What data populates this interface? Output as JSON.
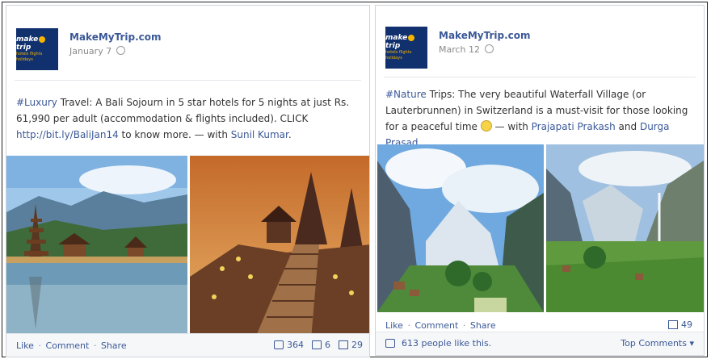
{
  "posts": [
    {
      "page_name": "MakeMyTrip.com",
      "date": "January 7",
      "logo": {
        "line1": "make",
        "line2": "trip",
        "tagline": "hotels flights holidays"
      },
      "text": {
        "tag": "#Luxury",
        "part1": " Travel: A Bali Sojourn in 5 star hotels for 5 nights at just Rs. 61,990 per adult (accommodation & flights included). CLICK ",
        "link": "http://bit.ly/BaliJan14",
        "part2": " to know more. — with ",
        "person1": "Sunil Kumar",
        "end": "."
      },
      "actions": {
        "like": "Like",
        "comment": "Comment",
        "share": "Share",
        "sep": "·"
      },
      "stats": {
        "likes": "364",
        "comments": "6",
        "shares": "29"
      }
    },
    {
      "page_name": "MakeMyTrip.com",
      "date": "March 12",
      "logo": {
        "line1": "make",
        "line2": "trip",
        "tagline": "hotels flights holidays"
      },
      "text": {
        "tag": "#Nature",
        "part1": " Trips: The very beautiful Waterfall Village (or Lauterbrunnen) in Switzerland is a must-visit for those looking for a peaceful time ",
        "part2": " — with ",
        "person1": "Prajapati Prakash",
        "and": " and ",
        "person2": "Durga Prasad",
        "end": "."
      },
      "actions": {
        "like": "Like",
        "comment": "Comment",
        "share": "Share",
        "sep": "·"
      },
      "stats": {
        "shares": "49"
      },
      "likes_text": "613 people like this.",
      "top_comments": "Top Comments ▾"
    }
  ],
  "colors": {
    "link": "#3b5998",
    "brand_navy": "#10306e",
    "brand_yellow": "#f7b500"
  }
}
